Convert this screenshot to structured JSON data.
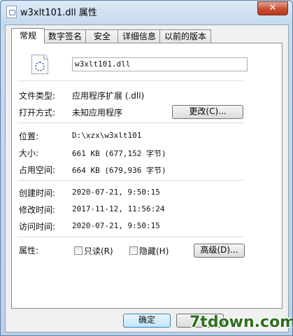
{
  "window": {
    "title": "w3xlt101.dll 属性",
    "close": "✕"
  },
  "tabs": [
    "常规",
    "数字签名",
    "安全",
    "详细信息",
    "以前的版本"
  ],
  "general": {
    "file_name": "w3xlt101.dll",
    "type_label": "文件类型:",
    "type_value": "应用程序扩展 (.dll)",
    "open_label": "打开方式:",
    "open_value": "未知应用程序",
    "change_button": "更改(C)...",
    "location_label": "位置:",
    "location_value": "D:\\xzx\\w3xlt101",
    "size_label": "大小:",
    "size_value": "661 KB (677,152 字节)",
    "disk_label": "占用空间:",
    "disk_value": "664 KB (679,936 字节)",
    "created_label": "创建时间:",
    "created_value": "2020-07-21, 9:50:15",
    "modified_label": "修改时间:",
    "modified_value": "2017-11-12, 11:56:24",
    "accessed_label": "访问时间:",
    "accessed_value": "2020-07-21, 9:50:15",
    "attributes_label": "属性:",
    "readonly_label": "只读(R)",
    "hidden_label": "隐藏(H)",
    "advanced_button": "高级(D)..."
  },
  "footer": {
    "ok": "确定",
    "cancel": ""
  },
  "watermark": "7tdown.com",
  "colors": {
    "title_bar": "#c8dbee",
    "close_button": "#c75031",
    "watermark": "#2d6f1c"
  }
}
